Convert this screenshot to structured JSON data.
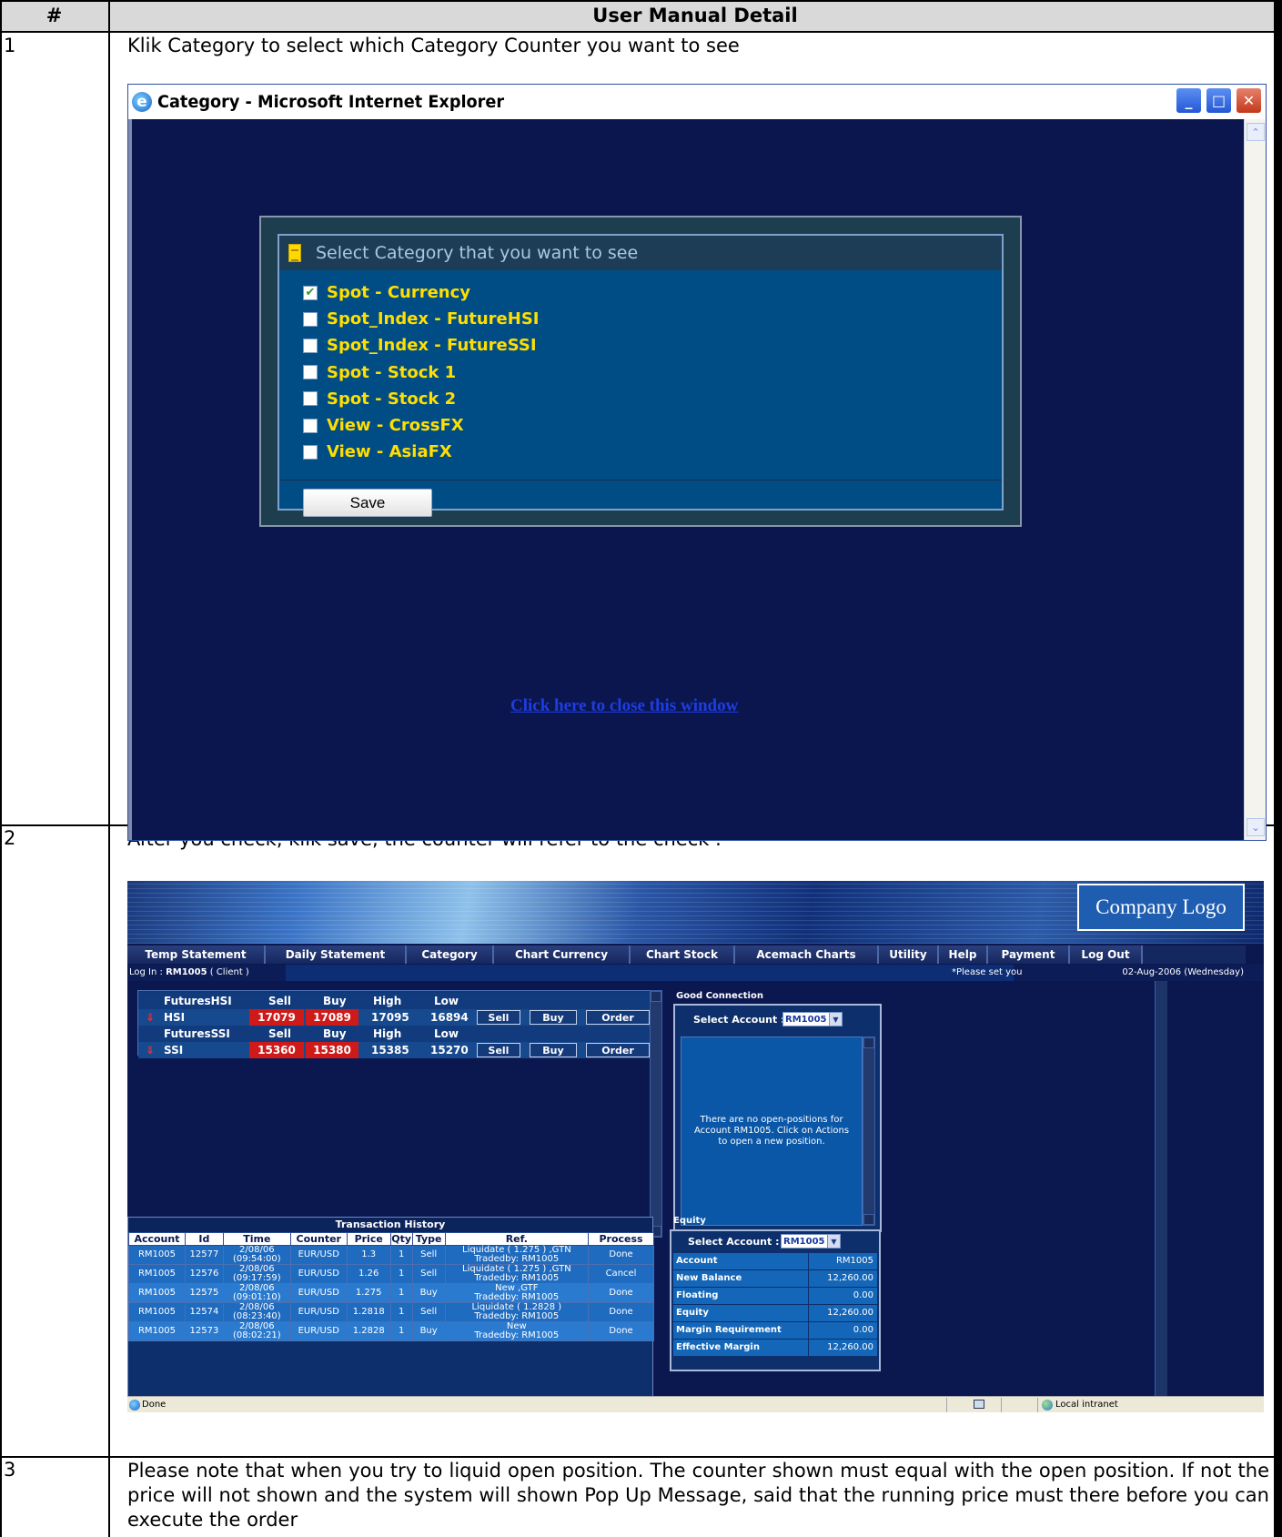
{
  "table": {
    "col_num": "#",
    "col_detail": "User Manual Detail",
    "rows": [
      {
        "num": "1",
        "text": "Klik Category to select which Category Counter you want to see"
      },
      {
        "num": "2",
        "text": "After you check, klik save, the counter will refer to the check ."
      },
      {
        "num": "3",
        "text": "Please note that when you try to liquid open position. The counter shown must equal with the open position. If not the price will not shown and the system will shown Pop Up Message, said that the running price must there before you can execute the order"
      }
    ]
  },
  "window1": {
    "title": "Category - Microsoft Internet Explorer",
    "icon": "ie-icon",
    "heading": "Select Category that you want to see",
    "items": [
      {
        "label": "Spot - Currency",
        "checked": true
      },
      {
        "label": "Spot_Index - FutureHSI",
        "checked": false
      },
      {
        "label": "Spot_Index - FutureSSI",
        "checked": false
      },
      {
        "label": "Spot - Stock 1",
        "checked": false
      },
      {
        "label": "Spot - Stock 2",
        "checked": false
      },
      {
        "label": "View - CrossFX",
        "checked": false
      },
      {
        "label": "View - AsiaFX",
        "checked": false
      }
    ],
    "save_label": "Save",
    "close_link": "Click here to close this window"
  },
  "window2": {
    "logo": "Company Logo",
    "menu": [
      "Temp Statement",
      "Daily Statement",
      "Category",
      "Chart Currency",
      "Chart Stock",
      "Acemach Charts",
      "Utility",
      "Help",
      "Payment",
      "Log Out"
    ],
    "login_prefix": "Log In : ",
    "login_user": "RM1005",
    "login_suffix": " ( Client )",
    "notice": "*Please set you",
    "date": "02-Aug-2006 (Wednesday)",
    "quotes": [
      {
        "group": "FuturesHSI",
        "sell_h": "Sell",
        "buy_h": "Buy",
        "high_h": "High",
        "low_h": "Low",
        "name": "HSI",
        "sell": "17079",
        "buy": "17089",
        "high": "17095",
        "low": "16894"
      },
      {
        "group": "FuturesSSI",
        "sell_h": "Sell",
        "buy_h": "Buy",
        "high_h": "High",
        "low_h": "Low",
        "name": "SSI",
        "sell": "15360",
        "buy": "15380",
        "high": "15385",
        "low": "15270"
      }
    ],
    "btn_sell": "Sell",
    "btn_buy": "Buy",
    "btn_order": "Order",
    "good_connection": "Good Connection",
    "select_account_label": "Select Account :",
    "select_account_value": "RM1005",
    "no_positions": "There are no open-positions for Account RM1005. Click on Actions to open a new position.",
    "tx_title": "Transaction History",
    "tx_headers": [
      "Account",
      "Id",
      "Time",
      "Counter",
      "Price",
      "Qty",
      "Type",
      "Ref.",
      "Process"
    ],
    "tx_rows": [
      {
        "account": "RM1005",
        "id": "12577",
        "date": "2/08/06",
        "time": "(09:54:00)",
        "counter": "EUR/USD",
        "price": "1.3",
        "qty": "1",
        "type": "Sell",
        "ref1": "Liquidate ( 1.275 ) ,GTN",
        "ref2": "Tradedby: RM1005",
        "process": "Done"
      },
      {
        "account": "RM1005",
        "id": "12576",
        "date": "2/08/06",
        "time": "(09:17:59)",
        "counter": "EUR/USD",
        "price": "1.26",
        "qty": "1",
        "type": "Sell",
        "ref1": "Liquidate ( 1.275 ) ,GTN",
        "ref2": "Tradedby: RM1005",
        "process": "Cancel"
      },
      {
        "account": "RM1005",
        "id": "12575",
        "date": "2/08/06",
        "time": "(09:01:10)",
        "counter": "EUR/USD",
        "price": "1.275",
        "qty": "1",
        "type": "Buy",
        "ref1": "New ,GTF",
        "ref2": "Tradedby: RM1005",
        "process": "Done"
      },
      {
        "account": "RM1005",
        "id": "12574",
        "date": "2/08/06",
        "time": "(08:23:40)",
        "counter": "EUR/USD",
        "price": "1.2818",
        "qty": "1",
        "type": "Sell",
        "ref1": "Liquidate ( 1.2828 )",
        "ref2": "Tradedby: RM1005",
        "process": "Done"
      },
      {
        "account": "RM1005",
        "id": "12573",
        "date": "2/08/06",
        "time": "(08:02:21)",
        "counter": "EUR/USD",
        "price": "1.2828",
        "qty": "1",
        "type": "Buy",
        "ref1": "New",
        "ref2": "Tradedby: RM1005",
        "process": "Done"
      }
    ],
    "equity_label": "Equity",
    "equity_rows": [
      {
        "k": "Account",
        "v": "RM1005"
      },
      {
        "k": "New Balance",
        "v": "12,260.00"
      },
      {
        "k": "Floating",
        "v": "0.00"
      },
      {
        "k": "Equity",
        "v": "12,260.00"
      },
      {
        "k": "Margin Requirement",
        "v": "0.00"
      },
      {
        "k": "Effective Margin",
        "v": "12,260.00"
      }
    ],
    "status_done": "Done",
    "status_zone": "Local intranet"
  }
}
